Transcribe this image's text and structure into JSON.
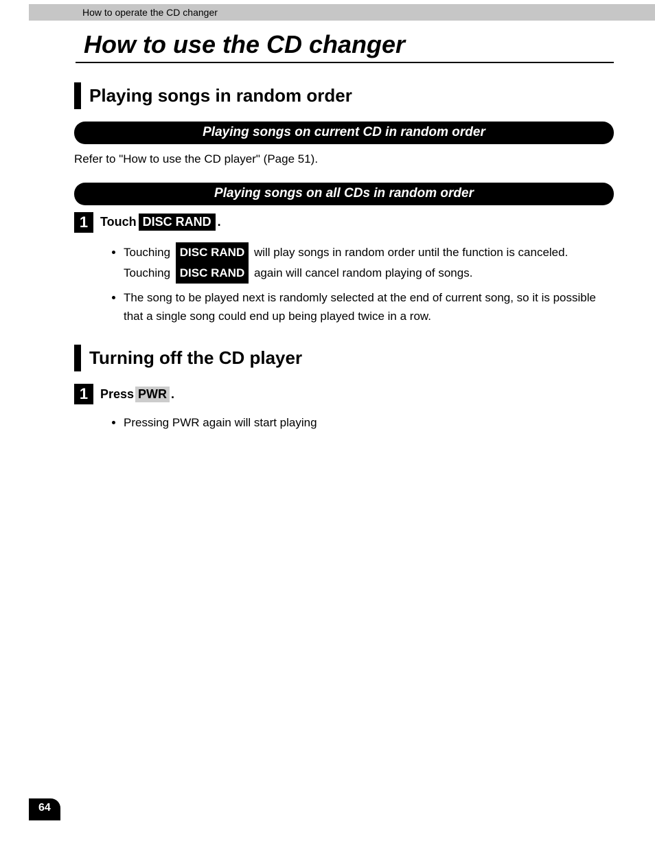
{
  "header": {
    "breadcrumb": "How to operate the CD changer"
  },
  "title": "How to use the CD changer",
  "sections": [
    {
      "heading": "Playing songs in random order",
      "subs": [
        {
          "pill": "Playing songs on current CD in random order",
          "para": "Refer to \"How to use the CD player\" (Page 51)."
        },
        {
          "pill": "Playing songs on all CDs in random order",
          "step_num": "1",
          "step_pre": "Touch ",
          "step_btn": "DISC RAND",
          "step_post": ".",
          "bullets": [
            {
              "pre": "Touching ",
              "btn1": "DISC RAND",
              "mid": " will play songs in random order until the function is canceled.  Touching ",
              "btn2": "DISC RAND",
              "post": " again will cancel random playing of songs."
            },
            {
              "plain": "The song to be played next is randomly selected at the end of current song, so it is possible that a single song could end up being played twice in a row."
            }
          ]
        }
      ]
    },
    {
      "heading": "Turning off the CD player",
      "step_num": "1",
      "step_pre": "Press ",
      "step_btn": "PWR",
      "step_post": ".",
      "bullets": [
        {
          "plain": "Pressing PWR again will start playing"
        }
      ]
    }
  ],
  "page_number": "64"
}
